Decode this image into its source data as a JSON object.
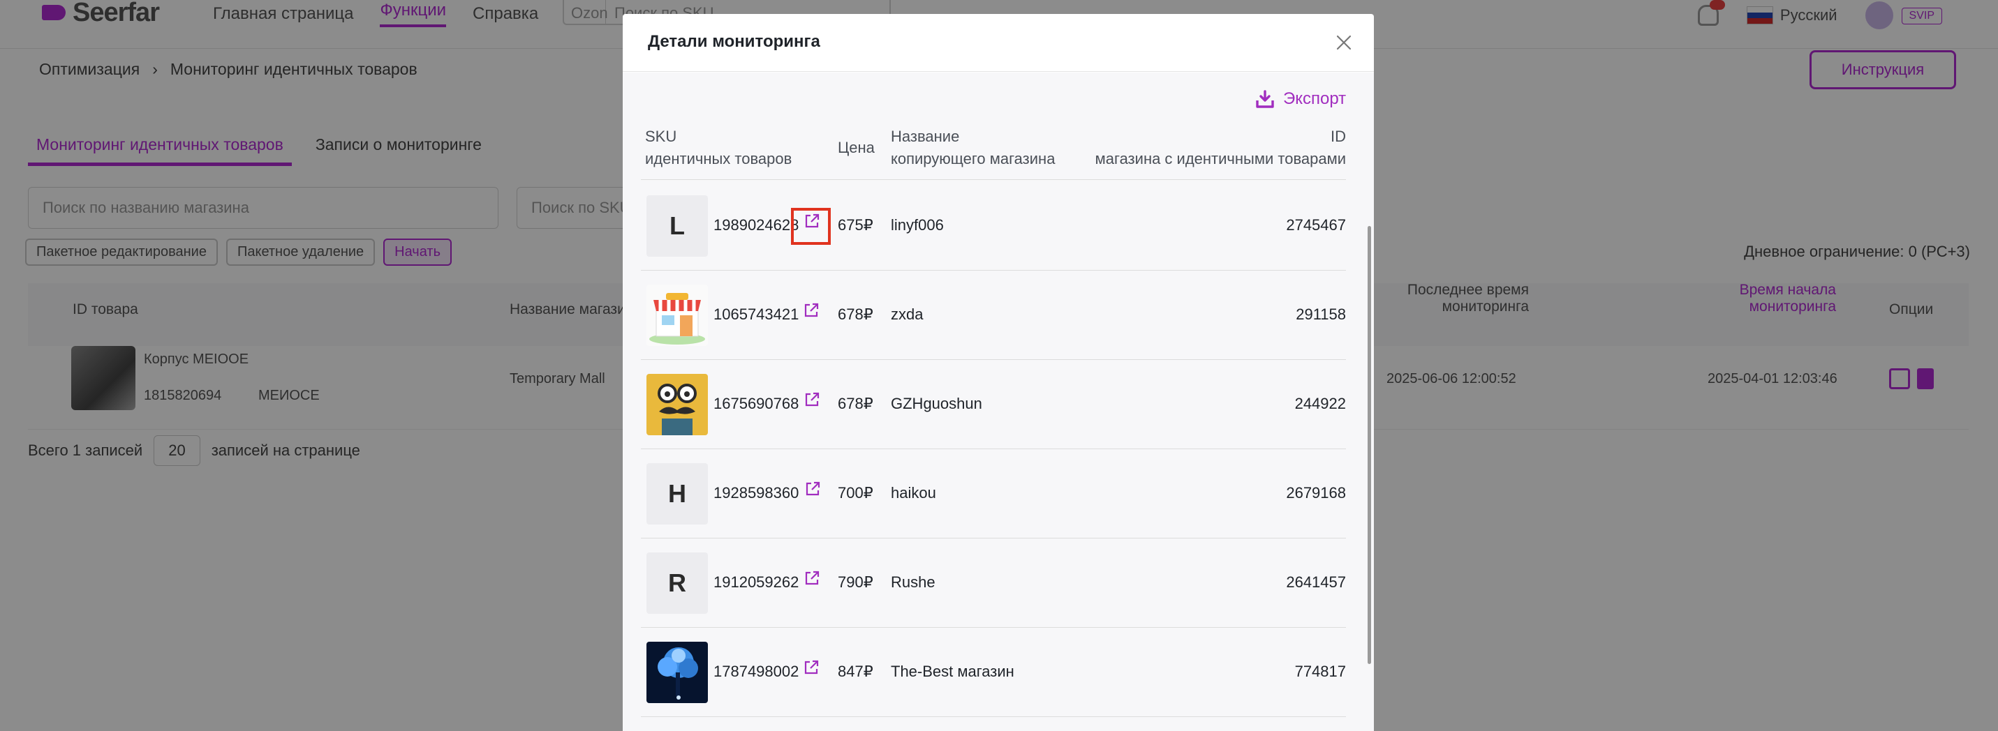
{
  "background": {
    "logo_text": "Seerfar",
    "nav": [
      "Главная страница",
      "Функции",
      "Справка"
    ],
    "nav_search_select": "Ozon",
    "nav_search_placeholder": "Поиск по SKU",
    "language": "Русский",
    "account_badge": "SVIP",
    "breadcrumb": [
      "Оптимизация",
      "›",
      "Мониторинг идентичных товаров"
    ],
    "instructions_button": "Инструкция",
    "tabs": [
      "Мониторинг идентичных товаров",
      "Записи о мониторинге"
    ],
    "search_shop_placeholder": "Поиск по названию магазина",
    "search_sku_placeholder": "Поиск по SKU",
    "chips": [
      "Пакетное редактирование",
      "Пакетное удаление",
      "Начать"
    ],
    "archive_note": "Дневное ограничение: 0 (РС+3)",
    "table_headers": [
      "ID товара",
      "Название магазина",
      "Последнее время мониторинга",
      "Время начала мониторинга",
      "Опции"
    ],
    "row": {
      "product": "Корпус MEIOOE",
      "sku": "1815820694",
      "shop": "Temporary Mall",
      "last_time": "2025-06-06 12:00:52",
      "start_time": "2025-04-01 12:03:46",
      "sku_extra": "МЕИОСЕ"
    },
    "pager_total": "Всего 1 записей",
    "pager_size": "20",
    "pager_suffix": "записей на странице"
  },
  "modal": {
    "title": "Детали мониторинга",
    "export_label": "Экспорт",
    "headers": {
      "sku_line1": "SKU",
      "sku_line2": "идентичных товаров",
      "price": "Цена",
      "name_line1": "Название",
      "name_line2": "копирующего магазина",
      "id_line1": "ID",
      "id_line2": "магазина с идентичными товарами"
    },
    "rows": [
      {
        "thumb_type": "letter",
        "thumb_letter": "L",
        "sku": "1989024628",
        "price": "675₽",
        "shop": "linyf006",
        "shop_id": "2745467"
      },
      {
        "thumb_type": "store-image",
        "thumb_letter": "",
        "sku": "1065743421",
        "price": "678₽",
        "shop": "zxda",
        "shop_id": "291158"
      },
      {
        "thumb_type": "mustache-image",
        "thumb_letter": "",
        "sku": "1675690768",
        "price": "678₽",
        "shop": "GZHguoshun",
        "shop_id": "244922"
      },
      {
        "thumb_type": "letter",
        "thumb_letter": "H",
        "sku": "1928598360",
        "price": "700₽",
        "shop": "haikou",
        "shop_id": "2679168"
      },
      {
        "thumb_type": "letter",
        "thumb_letter": "R",
        "sku": "1912059262",
        "price": "790₽",
        "shop": "Rushe",
        "shop_id": "2641457"
      },
      {
        "thumb_type": "tree-image",
        "thumb_letter": "",
        "sku": "1787498002",
        "price": "847₽",
        "shop": "The-Best магазин",
        "shop_id": "774817"
      }
    ]
  },
  "colors": {
    "accent": "#a12dbf",
    "highlight": "#e0331f"
  }
}
